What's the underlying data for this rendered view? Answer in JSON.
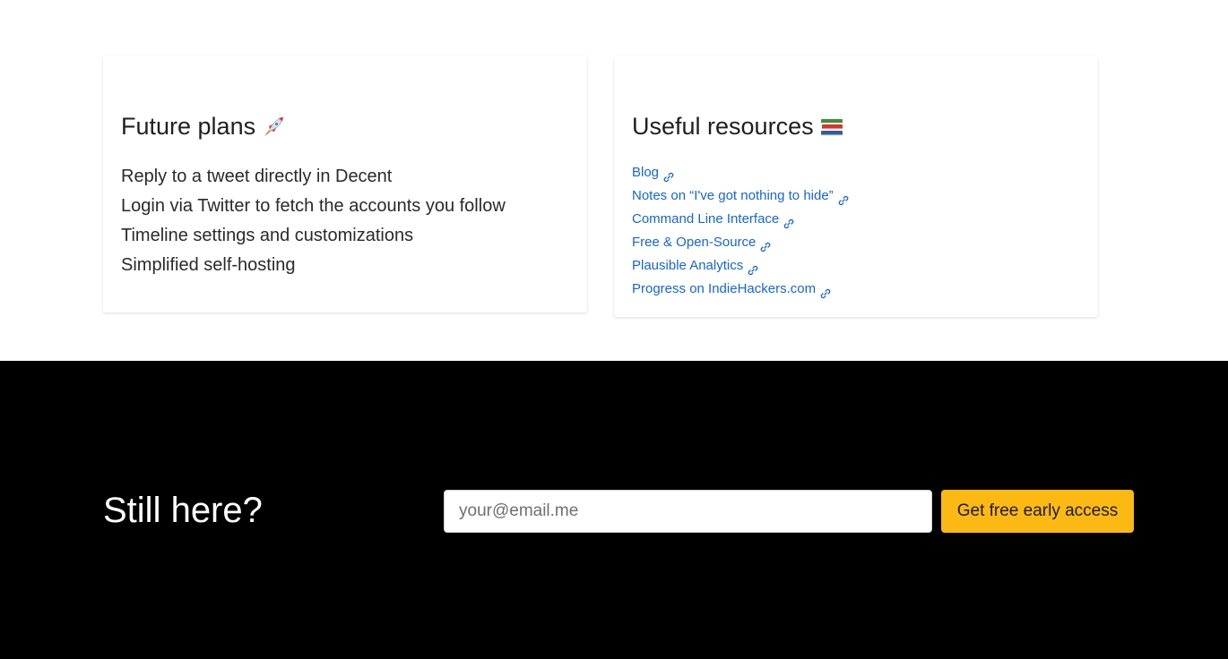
{
  "future_plans": {
    "title": "Future plans",
    "icon": "rocket-icon",
    "items": [
      "Reply to a tweet directly in Decent",
      "Login via Twitter to fetch the accounts you follow",
      "Timeline settings and customizations",
      "Simplified self-hosting"
    ]
  },
  "useful_resources": {
    "title": "Useful resources",
    "icon": "books-icon",
    "links": [
      {
        "label": "Blog",
        "icon": "link-icon"
      },
      {
        "label": "Notes on “I've got nothing to hide”",
        "icon": "link-icon"
      },
      {
        "label": "Command Line Interface",
        "icon": "link-icon"
      },
      {
        "label": "Free & Open-Source",
        "icon": "link-icon"
      },
      {
        "label": "Plausible Analytics",
        "icon": "link-icon"
      },
      {
        "label": "Progress on IndieHackers.com",
        "icon": "link-icon"
      }
    ]
  },
  "cta": {
    "title": "Still here?",
    "email_placeholder": "your@email.me",
    "email_value": "",
    "button_label": "Get free early access"
  },
  "colors": {
    "link": "#1565d8",
    "cta_button": "#fdb913",
    "footer_bg": "#000000"
  }
}
